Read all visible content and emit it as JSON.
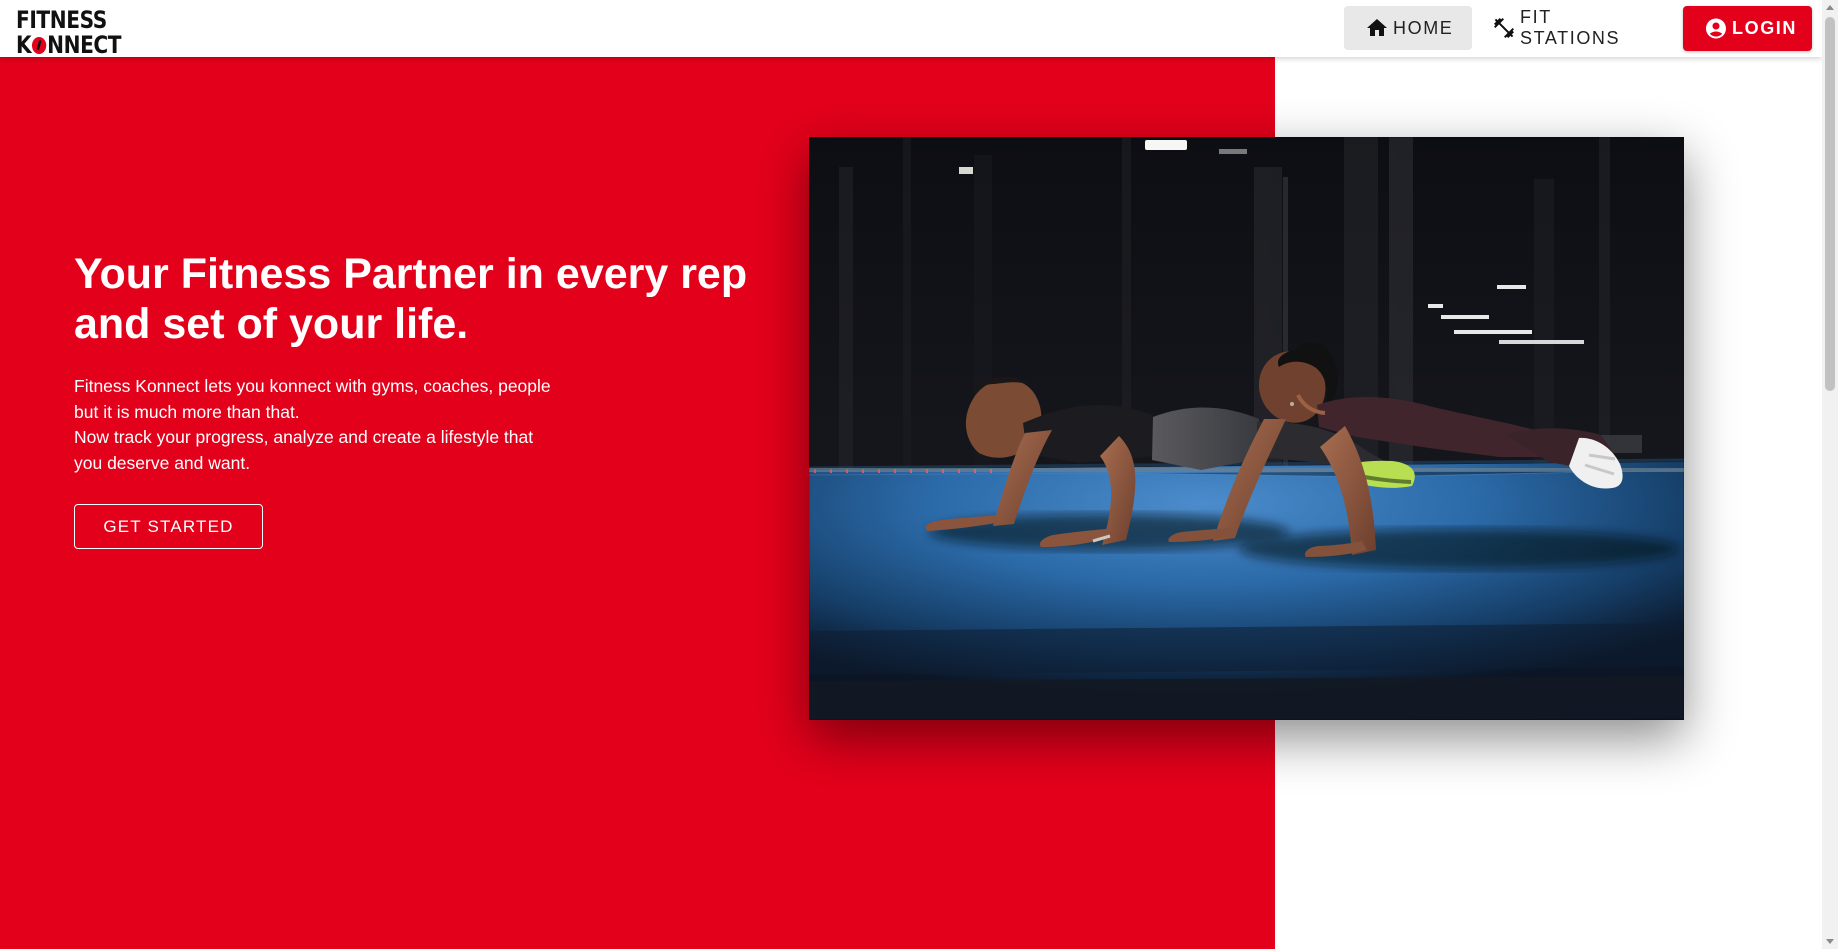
{
  "brand": {
    "logo_line1": "FITNESS",
    "logo_line2_start": "K",
    "logo_line2_end": "NNECT",
    "accent_color": "#e3001b"
  },
  "nav": {
    "items": [
      {
        "label": "HOME",
        "icon": "home-icon",
        "active": true
      },
      {
        "label": "FIT STATIONS",
        "icon": "fitness-center-icon",
        "active": false
      },
      {
        "label": "LOGIN",
        "icon": "account-circle-icon",
        "active": false
      }
    ]
  },
  "hero": {
    "headline": "Your Fitness Partner in every rep and set of your life.",
    "description_lines": [
      "Fitness Konnect lets you konnect with gyms, coaches, people",
      "but it is much more than that.",
      "Now track your progress, analyze and create a lifestyle that",
      "you deserve and want."
    ],
    "cta_label": "GET STARTED"
  },
  "image": {
    "description_icon": "push-up-workout-photo"
  }
}
